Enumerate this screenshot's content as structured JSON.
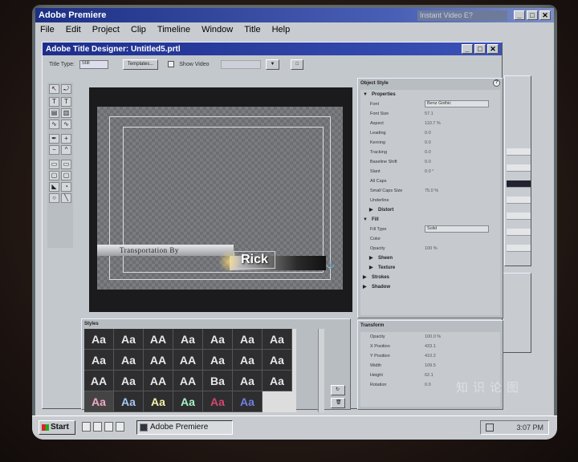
{
  "app": {
    "title": "Adobe Premiere",
    "instant_video": "Instant Video E?",
    "controls": [
      "_",
      "□",
      "✕"
    ]
  },
  "menu": [
    "File",
    "Edit",
    "Project",
    "Clip",
    "Timeline",
    "Window",
    "Title",
    "Help"
  ],
  "designer": {
    "title": "Adobe Title Designer: Untitled5.prtl",
    "toolbar": {
      "title_type_label": "Title Type:",
      "title_type_value": "Still",
      "templates_label": "Templates...",
      "show_video_label": "Show Video"
    }
  },
  "canvas": {
    "lower_third_text": "Transportation By",
    "name_text": "Rick"
  },
  "object_style": {
    "title": "Object Style",
    "properties_label": "Properties",
    "props": [
      {
        "k": "Font",
        "v": "Benz Gothic",
        "dropdown": true
      },
      {
        "k": "Font Size",
        "v": "57.1"
      },
      {
        "k": "Aspect",
        "v": "110.7 %"
      },
      {
        "k": "Leading",
        "v": "0.0"
      },
      {
        "k": "Kerning",
        "v": "0.0"
      },
      {
        "k": "Tracking",
        "v": "0.0"
      },
      {
        "k": "Baseline Shift",
        "v": "0.0"
      },
      {
        "k": "Slant",
        "v": "0.0 °"
      },
      {
        "k": "All Caps",
        "v": ""
      },
      {
        "k": "Small Caps Size",
        "v": "75.0 %"
      },
      {
        "k": "Underline",
        "v": ""
      }
    ],
    "distort_label": "Distort",
    "fill_label": "Fill",
    "fill_props": [
      {
        "k": "Fill Type",
        "v": "Solid",
        "dropdown": true
      },
      {
        "k": "Color",
        "v": ""
      },
      {
        "k": "Opacity",
        "v": "100 %"
      }
    ],
    "sheen_label": "Sheen",
    "texture_label": "Texture",
    "strokes_label": "Strokes",
    "shadow_label": "Shadow"
  },
  "styles": {
    "title": "Styles",
    "swatches": [
      "Aa",
      "Aa",
      "AA",
      "Aa",
      "Aa",
      "Aa",
      "Aa",
      "Aa",
      "Aa",
      "AA",
      "AA",
      "Aa",
      "Aa",
      "Aa",
      "AA",
      "Aa",
      "AA",
      "AA",
      "Ba",
      "Aa",
      "Aa",
      "Aa",
      "Aa",
      "Aa",
      "Aa",
      "Aa",
      "Aa"
    ]
  },
  "transform": {
    "title": "Transform",
    "props": [
      {
        "k": "Opacity",
        "v": "100.0 %"
      },
      {
        "k": "X Position",
        "v": "433.1"
      },
      {
        "k": "Y Position",
        "v": "410.2"
      },
      {
        "k": "Width",
        "v": "109.5"
      },
      {
        "k": "Height",
        "v": "62.1"
      },
      {
        "k": "Rotation",
        "v": "0.0"
      }
    ]
  },
  "taskbar": {
    "start_label": "Start",
    "task_label": "Adobe Premiere",
    "clock": "3:07 PM"
  },
  "watermark": "知识论图"
}
